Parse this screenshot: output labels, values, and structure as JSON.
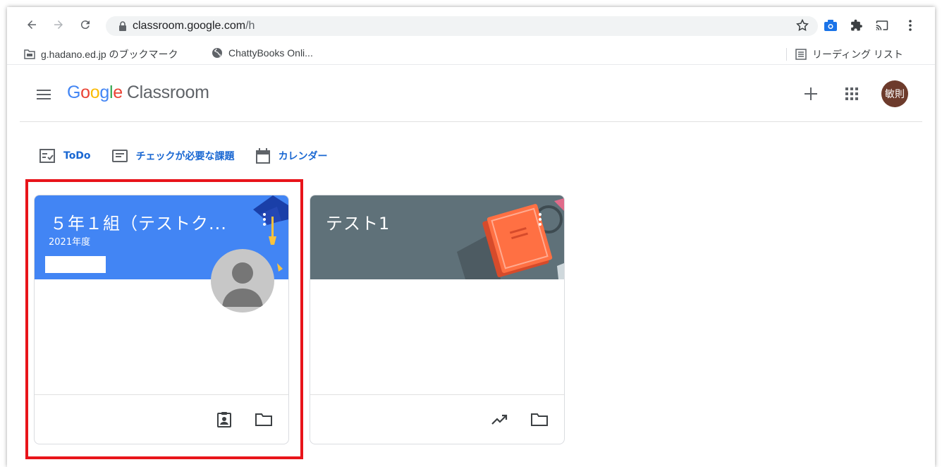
{
  "browser": {
    "url_host": "classroom.google.com",
    "url_path": "/h"
  },
  "bookmarks": {
    "items": [
      {
        "label": "g.hadano.ed.jp のブックマーク",
        "icon": "folder-icon"
      },
      {
        "label": "ChattyBooks Onli...",
        "icon": "globe-icon"
      }
    ],
    "reading_list": "リーディング リスト"
  },
  "app": {
    "brand_letters": [
      "G",
      "o",
      "o",
      "g",
      "l",
      "e"
    ],
    "product": "Classroom",
    "avatar_text": "敏則"
  },
  "subnav": {
    "todo": "ToDo",
    "review": "チェックが必要な課題",
    "calendar": "カレンダー"
  },
  "cards": [
    {
      "title": "５年１組（テストク...",
      "subtitle": "2021年度",
      "header_color": "#4285f4"
    },
    {
      "title": "テスト1",
      "subtitle": "",
      "header_color": "#5f7179"
    }
  ],
  "colors": {
    "accent_blue": "#1967d2",
    "highlight": "#e8141a",
    "avatar_bg": "#6d3b2c"
  }
}
